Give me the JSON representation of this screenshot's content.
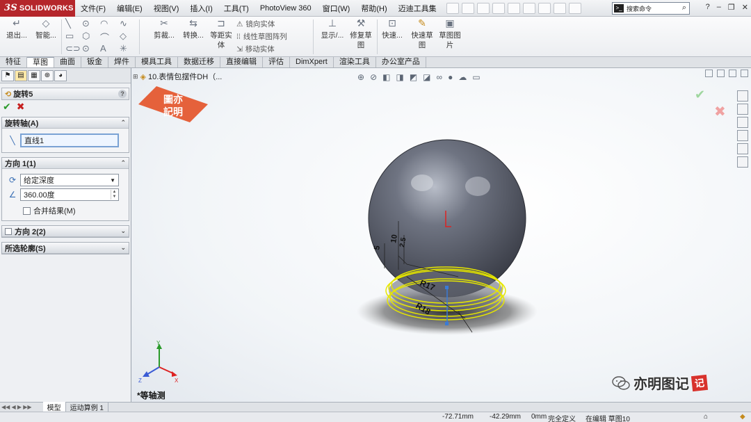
{
  "app": {
    "logo_mark": "3S",
    "logo_text": "SOLIDWORKS"
  },
  "menu": [
    "文件(F)",
    "编辑(E)",
    "视图(V)",
    "插入(I)",
    "工具(T)",
    "PhotoView 360",
    "窗口(W)",
    "帮助(H)",
    "迈迪工具集"
  ],
  "search": {
    "placeholder": "搜索命令"
  },
  "ribbon": {
    "exit": "退出...",
    "smart": "智能...",
    "trim": "剪裁...",
    "convert": "转换...",
    "equidistant": "等距实体",
    "mirror": "镜向实体",
    "linear_array": "线性草图阵列",
    "move": "移动实体",
    "display": "显示/...",
    "repair": "修复草图",
    "quick": "快速...",
    "quick_sketch": "快速草图",
    "sketch_pic": "草图图片"
  },
  "tabs": [
    "特征",
    "草图",
    "曲面",
    "钣金",
    "焊件",
    "模具工具",
    "数据迁移",
    "直接编辑",
    "评估",
    "DimXpert",
    "渲染工具",
    "办公室产品"
  ],
  "active_tab": "草图",
  "panel": {
    "title": "旋转5",
    "help": "?",
    "axis_group": "旋转轴(A)",
    "axis_value": "直线1",
    "dir1_group": "方向 1(1)",
    "dir1_type": "给定深度",
    "dir1_angle": "360.00度",
    "merge_label": "合并结果(M)",
    "dir2_group": "方向 2(2)",
    "contours_group": "所选轮廓(S)"
  },
  "viewport": {
    "tree_item": "10.表情包摆件DH（...",
    "view_name": "*等轴测",
    "dims": {
      "r17": "R17",
      "r18": "R18",
      "d5": "5",
      "d10": "10",
      "d25": "2.5"
    },
    "triad": {
      "x": "X",
      "y": "Y",
      "z": "Z"
    }
  },
  "watermark": {
    "brand_name": "亦明图记",
    "seal_char": "记",
    "stamp_text": "图亦記明"
  },
  "bottom_tabs": [
    "模型",
    "运动算例 1"
  ],
  "status": {
    "x": "-72.71mm",
    "y": "-42.29mm",
    "z": "0mm",
    "defined": "完全定义",
    "editing": "在编辑 草图10"
  },
  "colors": {
    "accent_red": "#b5262b",
    "sphere": "#5b5f6b",
    "sketch_yellow": "#e8e800",
    "axis_blue": "#3a7bd5"
  }
}
